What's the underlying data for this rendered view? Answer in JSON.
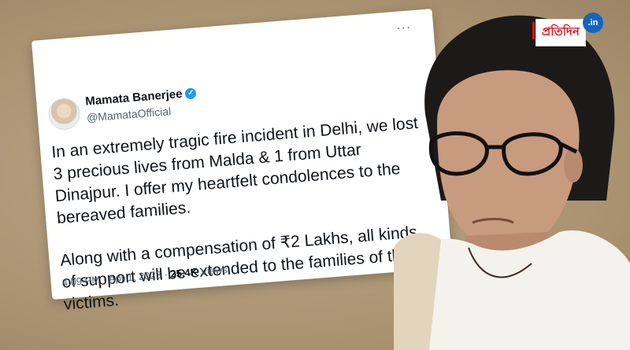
{
  "tweet": {
    "author_name": "Mamata Banerjee",
    "handle": "@MamataOfficial",
    "paragraph_1": "In an extremely tragic fire incident in Delhi, we lost 3 precious lives from Malda & 1 from Uttar Dinajpur. I offer my heartfelt condolences to the bereaved families.",
    "paragraph_2": "Along with a compensation of ₹2 Lakhs, all kinds of support will be extended to the families of the victims.",
    "time": "4:09 PM",
    "date": "Apr 1, 2023",
    "views_count": "25.4K",
    "views_label": "Views",
    "more_icon": "···"
  },
  "logo": {
    "word": "প্রতিদিন",
    "tld": ".in"
  },
  "colors": {
    "background": "#b09a7a",
    "verified": "#1d9bf0",
    "logo_red": "#d6141d",
    "logo_blue": "#1565c0"
  }
}
